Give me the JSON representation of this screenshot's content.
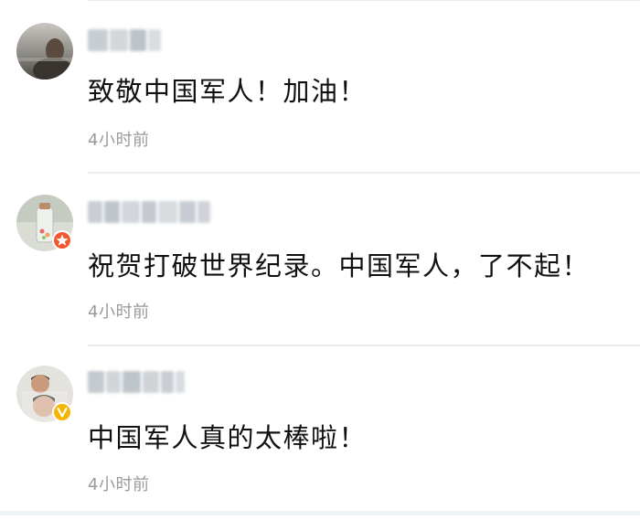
{
  "comments": [
    {
      "avatar": "avatar-person-seaside",
      "username_redacted": true,
      "text": "致敬中国军人！加油！",
      "time": "4小时前",
      "badge": null
    },
    {
      "avatar": "avatar-bottle",
      "username_redacted": true,
      "text": "祝贺打破世界纪录。中国军人，了不起！",
      "time": "4小时前",
      "badge": "star-badge-icon"
    },
    {
      "avatar": "avatar-children",
      "username_redacted": true,
      "text": "中国军人真的太棒啦！",
      "time": "4小时前",
      "badge": "verified-v-badge-icon"
    }
  ],
  "colors": {
    "text": "#111111",
    "time": "#9a9a9a",
    "divider": "#ececec",
    "star_badge": "#f2572f",
    "verified_badge": "#f5b400"
  }
}
